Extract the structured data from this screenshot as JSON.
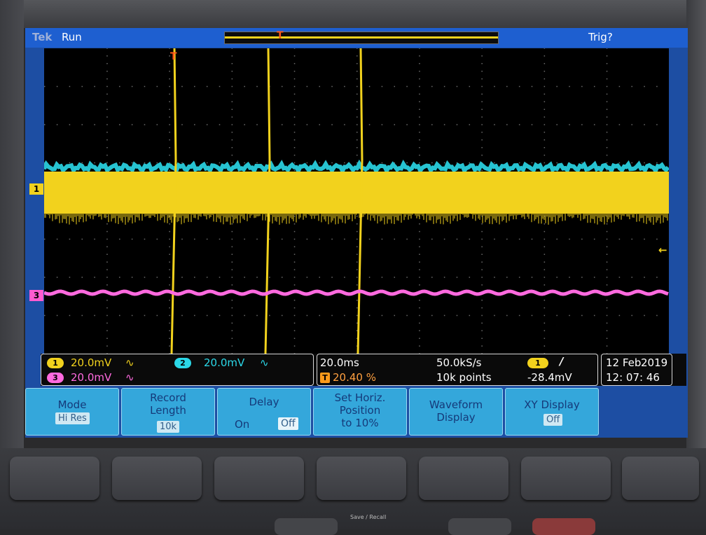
{
  "header": {
    "brand": "Tek",
    "run_status": "Run",
    "trigger_status": "Trig?"
  },
  "markers": {
    "ch1": "1",
    "ch3": "3",
    "trigger": "T"
  },
  "channels": [
    {
      "id": "1",
      "scale": "20.0mV",
      "coupling": "∿",
      "color": "#f2d21d"
    },
    {
      "id": "2",
      "scale": "20.0mV",
      "coupling": "∿",
      "color": "#2bd8e8"
    },
    {
      "id": "3",
      "scale": "20.0mV",
      "coupling": "∿",
      "color": "#ff6adf"
    }
  ],
  "timebase": {
    "scale": "20.0ms",
    "trigger_position_badge": "T",
    "trigger_position": "20.40 %",
    "sample_rate": "50.0kS/s",
    "record_points": "10k points"
  },
  "trigger": {
    "source": "1",
    "slope": "/",
    "level": "-28.4mV"
  },
  "datetime": {
    "date_day_month": "12 Feb",
    "year": "2019",
    "time": "12: 07: 46"
  },
  "menu": [
    {
      "label": "Mode",
      "value": "Hi Res"
    },
    {
      "label": "Record\nLength",
      "value": "10k"
    },
    {
      "label": "Delay",
      "options": [
        "On",
        "Off"
      ],
      "selected": "Off"
    },
    {
      "label": "Set Horiz.\nPosition\nto 10%"
    },
    {
      "label": "Waveform\nDisplay"
    },
    {
      "label": "XY Display",
      "value": "Off"
    }
  ],
  "front_panel": {
    "save_recall": "Save / Recall"
  },
  "colors": {
    "screen_blue": "#1d4ea3",
    "menu_button": "#34a7db",
    "ch1_yellow": "#f2d21d",
    "ch2_cyan": "#2bd8e8",
    "ch3_magenta": "#ff6adf",
    "trigger_orange": "#ff5a1a"
  }
}
